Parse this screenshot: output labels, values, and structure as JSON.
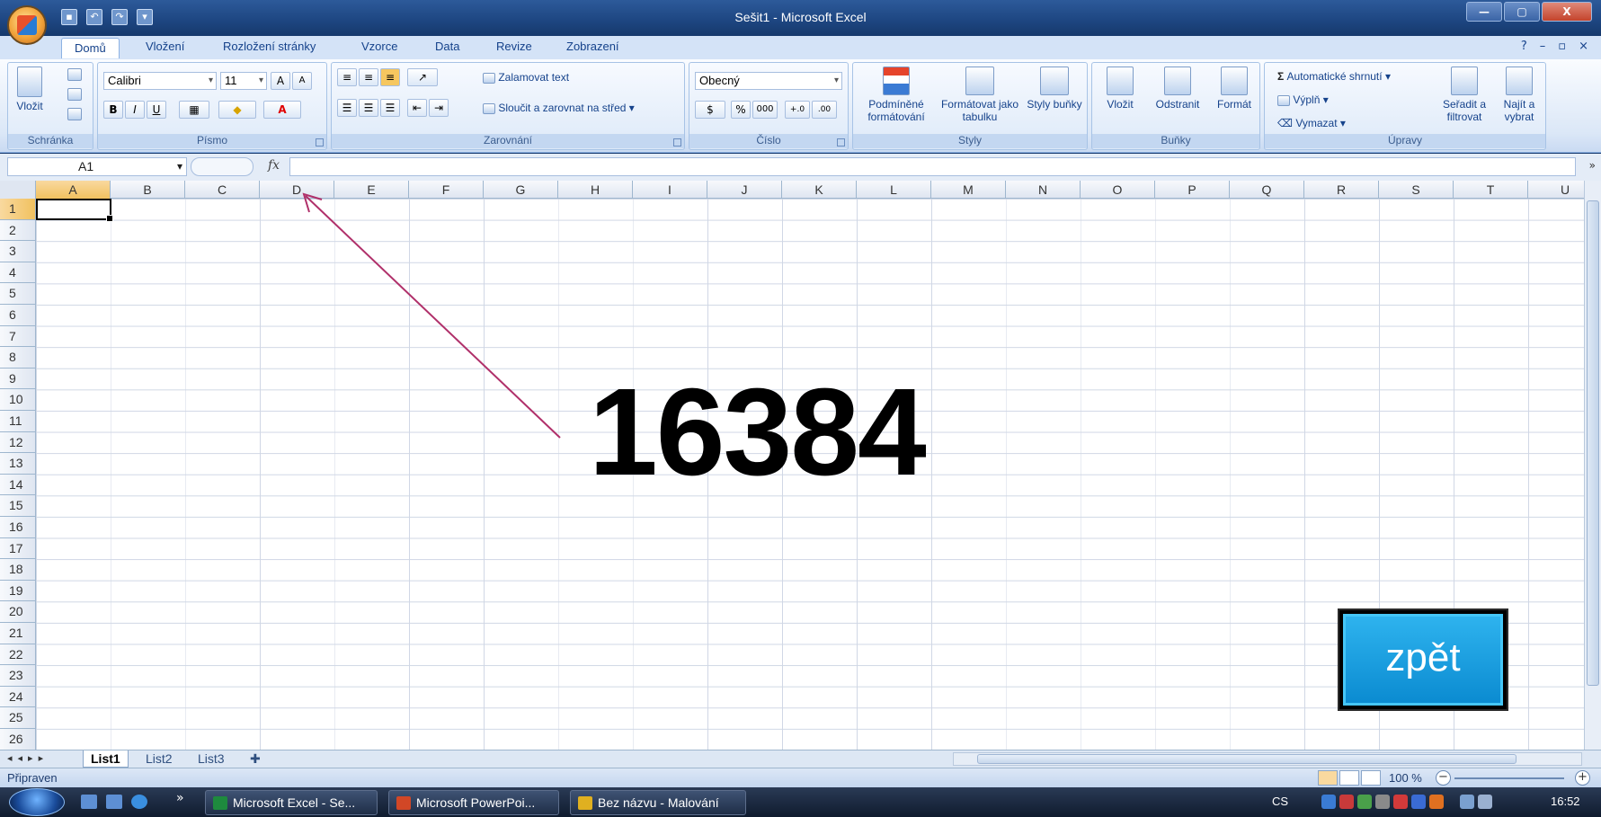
{
  "window": {
    "title": "Sešit1 - Microsoft Excel",
    "controls": [
      "—",
      "▢",
      "X"
    ]
  },
  "ribbon_tabs": [
    "Domů",
    "Vložení",
    "Rozložení stránky",
    "Vzorce",
    "Data",
    "Revize",
    "Zobrazení"
  ],
  "ribbon": {
    "clipboard": {
      "paste": "Vložit",
      "label": "Schránka"
    },
    "font": {
      "name": "Calibri",
      "size": "11",
      "bold": "B",
      "italic": "I",
      "underline": "U",
      "label": "Písmo"
    },
    "alignment": {
      "wrap": "Zalamovat text",
      "merge": "Sloučit a zarovnat na střed",
      "label": "Zarovnání"
    },
    "number": {
      "format": "Obecný",
      "percent": "%",
      "thousands": "000",
      "label": "Číslo"
    },
    "styles": {
      "conditional": "Podmíněné formátování",
      "table": "Formátovat jako tabulku",
      "cell": "Styly buňky",
      "label": "Styly"
    },
    "cells": {
      "insert": "Vložit",
      "delete": "Odstranit",
      "format": "Formát",
      "label": "Buňky"
    },
    "editing": {
      "autosum": "Automatické shrnutí",
      "fill": "Výplň",
      "clear": "Vymazat",
      "sort": "Seřadit a filtrovat",
      "find": "Najít a vybrat",
      "label": "Úpravy"
    }
  },
  "formula_bar": {
    "name_box": "A1",
    "fx": "fx",
    "value": ""
  },
  "columns": [
    "A",
    "B",
    "C",
    "D",
    "E",
    "F",
    "G",
    "H",
    "I",
    "J",
    "K",
    "L",
    "M",
    "N",
    "O",
    "P",
    "Q",
    "R",
    "S",
    "T",
    "U"
  ],
  "rows": [
    "1",
    "2",
    "3",
    "4",
    "5",
    "6",
    "7",
    "8",
    "9",
    "10",
    "11",
    "12",
    "13",
    "14",
    "15",
    "16",
    "17",
    "18",
    "19",
    "20",
    "21",
    "22",
    "23",
    "24",
    "25",
    "26"
  ],
  "overlay": {
    "big_number": "16384",
    "back_button": "zpět"
  },
  "sheets": [
    "List1",
    "List2",
    "List3"
  ],
  "status": {
    "ready": "Připraven",
    "zoom": "100 %"
  },
  "taskbar": {
    "tasks": [
      "Microsoft Excel - Se...",
      "Microsoft PowerPoi...",
      "Bez názvu - Malování"
    ],
    "language": "CS",
    "clock": "16:52"
  }
}
